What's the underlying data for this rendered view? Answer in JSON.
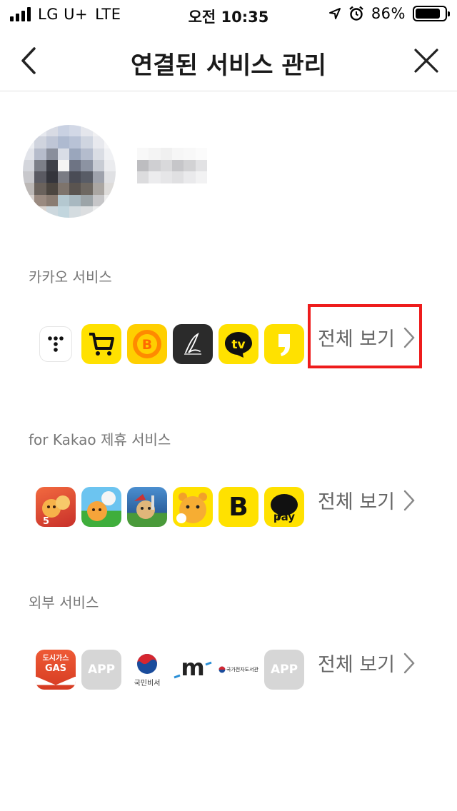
{
  "status_bar": {
    "carrier": "LG U+",
    "network": "LTE",
    "time": "오전 10:35",
    "battery": "86%",
    "battery_level": 0.86
  },
  "nav": {
    "title": "연결된 서비스 관리",
    "back_icon": "chevron-left-icon",
    "close_icon": "close-icon"
  },
  "sections": [
    {
      "title": "카카오 서비스",
      "see_all": "전체 보기",
      "apps": [
        {
          "icon": "kakao-t-icon",
          "bg": "#ffffff"
        },
        {
          "icon": "shopping-cart-icon",
          "bg": "#ffe100"
        },
        {
          "icon": "kakao-bank-coin-icon",
          "bg": "#ffcf00"
        },
        {
          "icon": "kakao-page-pen-icon",
          "bg": "#2b2b2b"
        },
        {
          "icon": "kakao-tv-icon",
          "bg": "#ffe100"
        },
        {
          "icon": "kakao-story-quote-icon",
          "bg": "#ffe100"
        }
      ]
    },
    {
      "title": "for Kakao 제휴 서비스",
      "see_all": "전체 보기",
      "apps": [
        {
          "icon": "game-icon-1",
          "bg": "#e44a3a"
        },
        {
          "icon": "game-golf-icon",
          "bg": "#58b3e8"
        },
        {
          "icon": "game-icon-3",
          "bg": "#3c7bb8"
        },
        {
          "icon": "game-ryan-icon",
          "bg": "#ffe100"
        },
        {
          "icon": "kakao-b-icon",
          "bg": "#ffe100"
        },
        {
          "icon": "kakao-pay-icon",
          "bg": "#ffe100"
        }
      ],
      "pay_label": "pay",
      "b_label": "B"
    },
    {
      "title": "외부 서비스",
      "see_all": "전체 보기",
      "apps": [
        {
          "icon": "dosi-gas-icon",
          "bg": "#e8452d"
        },
        {
          "icon": "app-placeholder-icon",
          "bg": "#d6d6d6"
        },
        {
          "icon": "gov-secretary-icon",
          "bg": "#ffffff"
        },
        {
          "icon": "m-logo-icon",
          "bg": "#ffffff"
        },
        {
          "icon": "national-library-icon",
          "bg": "#ffffff"
        },
        {
          "icon": "app-placeholder-icon",
          "bg": "#d6d6d6"
        }
      ],
      "gas_top": "도시가스",
      "gas_bottom": "GAS",
      "placeholder_label": "APP",
      "gov_label": "국민비서",
      "m_label": "m",
      "library_label": "국가전자도서관"
    }
  ],
  "colors": {
    "kakao_yellow": "#ffe100",
    "highlight_red": "#ee1c1c",
    "section_title_gray": "#777777",
    "see_all_gray": "#666666"
  }
}
